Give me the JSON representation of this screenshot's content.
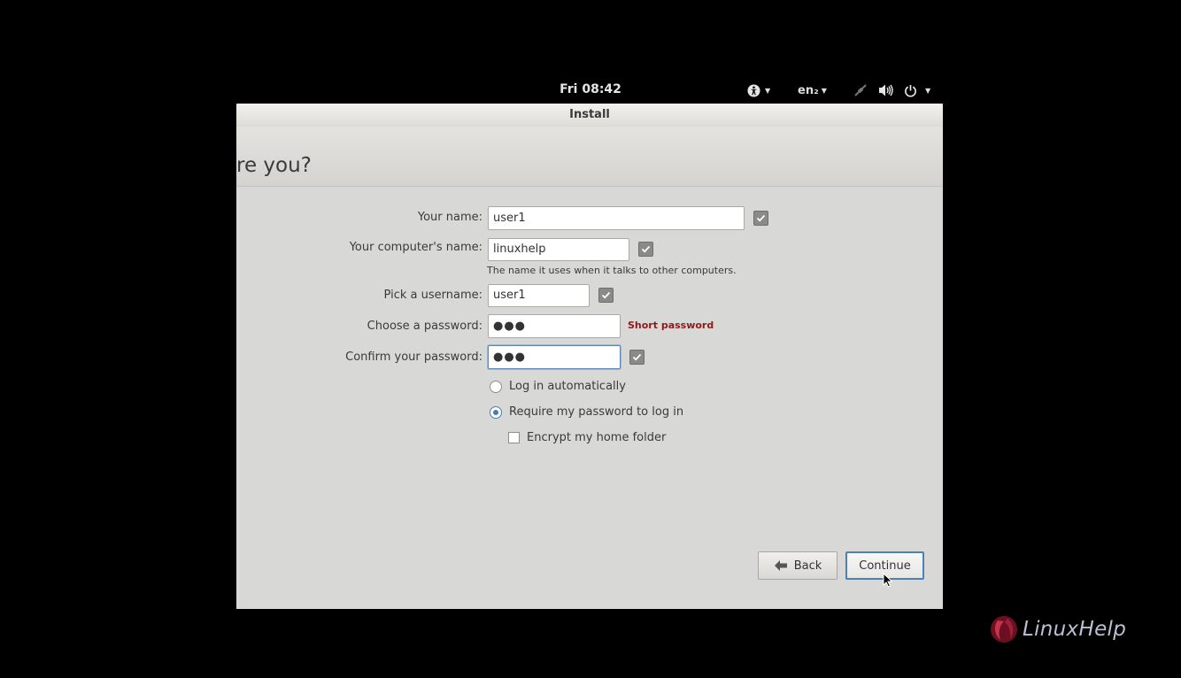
{
  "panel": {
    "clock": "Fri 08:42",
    "keyboard_layout": "en₂"
  },
  "window": {
    "title": "Install",
    "heading": "re you?"
  },
  "form": {
    "name_label": "Your name:",
    "name_value": "user1",
    "computer_label": "Your computer's name:",
    "computer_value": "linuxhelp",
    "computer_hint": "The name it uses when it talks to other computers.",
    "username_label": "Pick a username:",
    "username_value": "user1",
    "password_label": "Choose a password:",
    "password_value": "●●●",
    "password_strength": "Short password",
    "confirm_label": "Confirm your password:",
    "confirm_value": "●●●"
  },
  "options": {
    "login_auto": "Log in automatically",
    "login_password": "Require my password to log in",
    "encrypt_home": "Encrypt my home folder",
    "login_auto_selected": false,
    "login_password_selected": true,
    "encrypt_home_checked": false
  },
  "buttons": {
    "back": "Back",
    "continue": "Continue"
  },
  "watermark": {
    "text": "LinuxHelp"
  },
  "colors": {
    "accent": "#4a7bb6",
    "warning": "#8e1a1a"
  }
}
